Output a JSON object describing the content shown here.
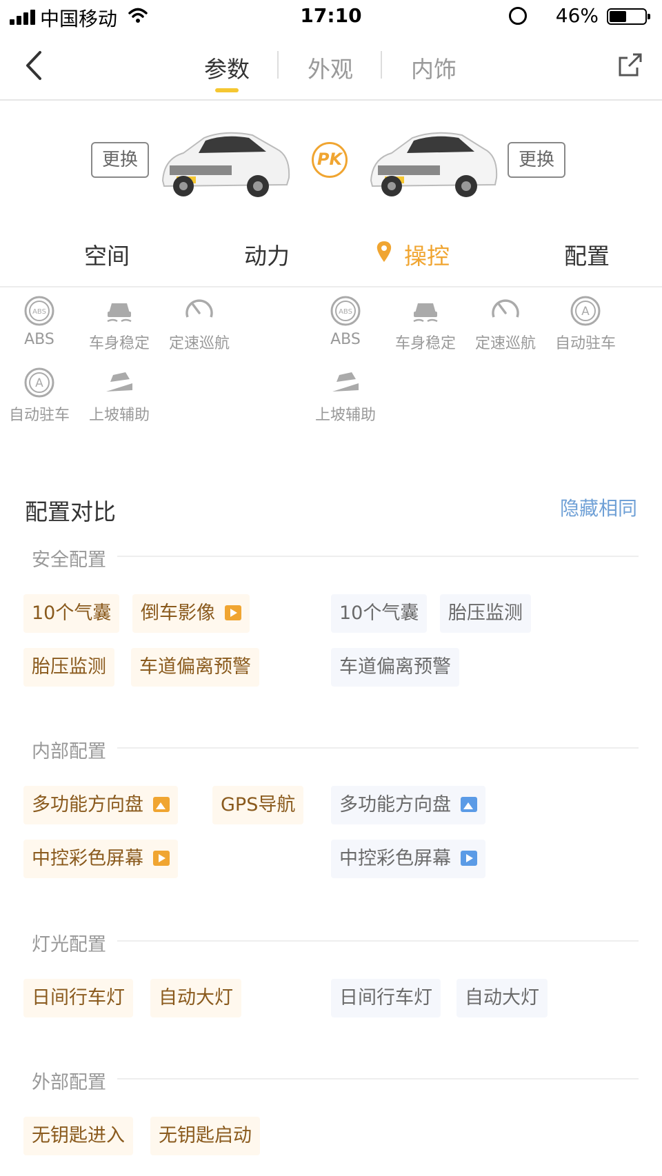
{
  "status": {
    "carrier": "中国移动",
    "time": "17:10",
    "battery": "46%"
  },
  "nav": {
    "tabs": [
      "参数",
      "外观",
      "内饰"
    ],
    "active_tab": "参数"
  },
  "cars": {
    "swap_label": "更换",
    "pk_label": "PK"
  },
  "categories": {
    "items": [
      "空间",
      "动力",
      "操控",
      "配置"
    ],
    "active": "操控"
  },
  "features_left": [
    {
      "label": "ABS",
      "icon": "abs-icon"
    },
    {
      "label": "车身稳定",
      "icon": "stability-icon"
    },
    {
      "label": "定速巡航",
      "icon": "cruise-icon"
    },
    {
      "label": "自动驻车",
      "icon": "auto-hold-icon"
    },
    {
      "label": "上坡辅助",
      "icon": "hill-assist-icon"
    }
  ],
  "features_right": [
    {
      "label": "ABS",
      "icon": "abs-icon"
    },
    {
      "label": "车身稳定",
      "icon": "stability-icon"
    },
    {
      "label": "定速巡航",
      "icon": "cruise-icon"
    },
    {
      "label": "自动驻车",
      "icon": "auto-hold-icon"
    },
    {
      "label": "上坡辅助",
      "icon": "hill-assist-icon"
    }
  ],
  "compare": {
    "title": "配置对比",
    "hide_same": "隐藏相同",
    "groups": [
      {
        "name": "安全配置",
        "left": [
          "10个气囊",
          "倒车影像",
          "胎压监测",
          "车道偏离预警"
        ],
        "right": [
          "10个气囊",
          "胎压监测",
          "车道偏离预警"
        ]
      },
      {
        "name": "内部配置",
        "left": [
          "多功能方向盘",
          "GPS导航",
          "中控彩色屏幕"
        ],
        "right": [
          "多功能方向盘",
          "中控彩色屏幕"
        ]
      },
      {
        "name": "灯光配置",
        "left": [
          "日间行车灯",
          "自动大灯"
        ],
        "right": [
          "日间行车灯",
          "自动大灯"
        ]
      },
      {
        "name": "外部配置",
        "left": [
          "无钥匙进入",
          "无钥匙启动"
        ],
        "right": []
      }
    ]
  },
  "colors": {
    "accent": "#f0a531",
    "tab_indicator": "#f5c732",
    "link": "#6fa0d6"
  }
}
